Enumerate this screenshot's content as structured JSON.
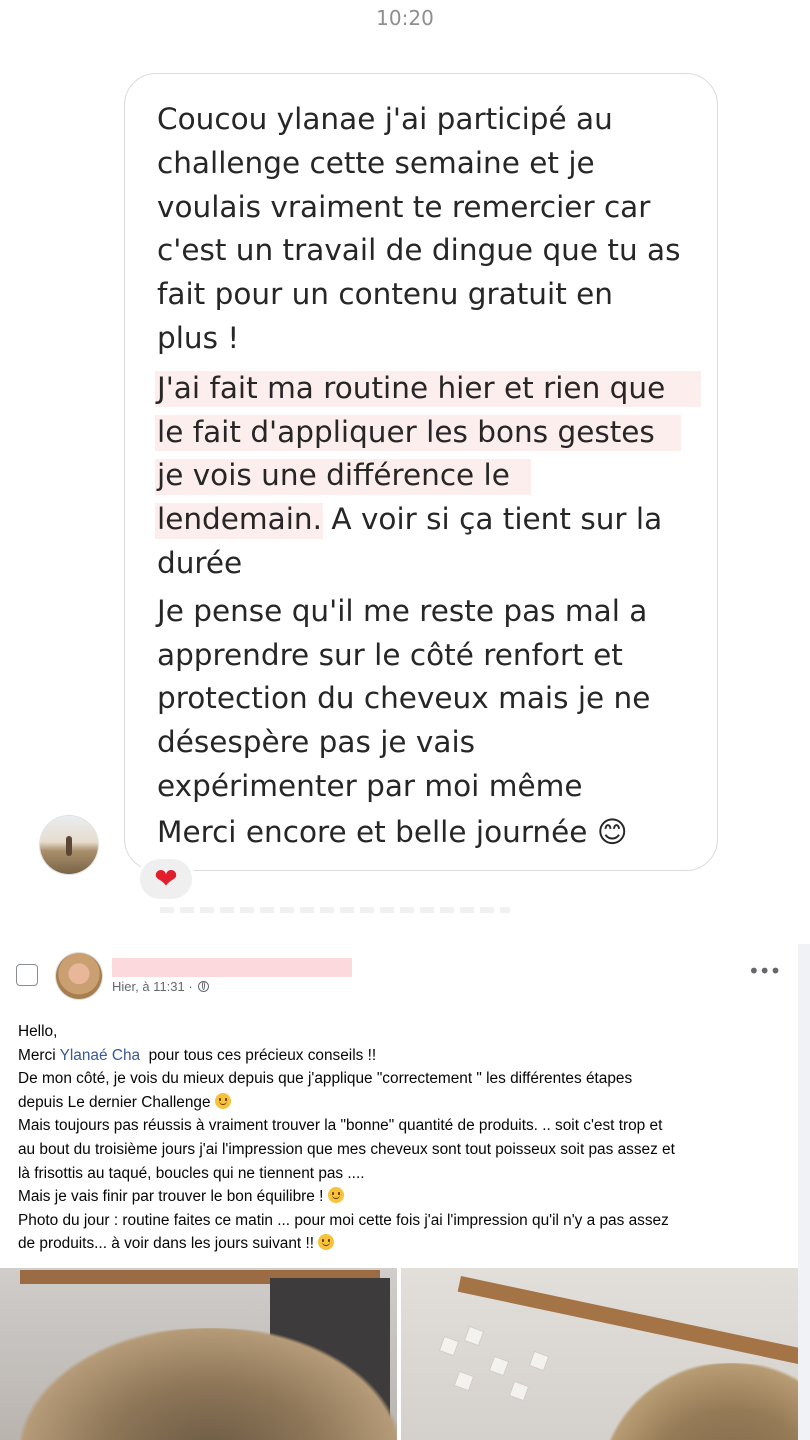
{
  "dm": {
    "time": "10:20",
    "message": {
      "p1": [
        "Coucou ylanae j'ai participé au",
        "challenge cette semaine et je",
        "voulais vraiment te remercier car",
        "c'est un travail de dingue que tu as",
        "fait pour un contenu gratuit en",
        "plus !"
      ],
      "p2_line1": "J'ai fait ma routine hier et rien que",
      "p2_line2": "le fait d'appliquer les bons gestes",
      "p2_line3": "je vois une différence le",
      "p2_line4_hl": "lendemain.",
      "p2_line4_rest": " A voir si ça tient sur la",
      "p2_line5": "durée",
      "p3": [
        "Je pense qu'il me reste pas mal a",
        "apprendre sur le côté renfort et",
        "protection du cheveux mais je ne",
        "désespère pas je vais",
        "expérimenter par moi même"
      ],
      "p4": "Merci encore et belle journée",
      "p4_emoji": "😊"
    },
    "reaction_icon": "heart-icon",
    "reaction_color": "#e01e2c"
  },
  "post": {
    "timestamp": "Hier, à 11:31 ·",
    "audience_icon": "globe-icon",
    "more_icon": "more-horizontal-icon",
    "lines": {
      "l1": "Hello,",
      "l2_pre": "Merci ",
      "l2_mention": "Ylanaé Cha",
      "l2_post": "  pour tous ces précieux conseils !!",
      "l3": "De mon côté,  je vois du mieux depuis que j'applique \"correctement \" les différentes étapes",
      "l4": "depuis Le dernier Challenge",
      "l5": "Mais toujours pas réussis à vraiment trouver la \"bonne\" quantité de produits. .. soit c'est trop et",
      "l6": "au bout du troisième jours j'ai l'impression que mes cheveux sont tout poisseux soit pas assez et",
      "l7": "là frisottis au taqué, boucles qui ne tiennent pas ....",
      "l8": "Mais je vais finir par trouver le bon équilibre !",
      "l9": "Photo du jour : routine faites ce matin ... pour moi cette fois j'ai l'impression qu'il n'y a pas assez",
      "l10": "de produits... à voir dans les jours suivant !!"
    },
    "mention_color": "#385898"
  }
}
